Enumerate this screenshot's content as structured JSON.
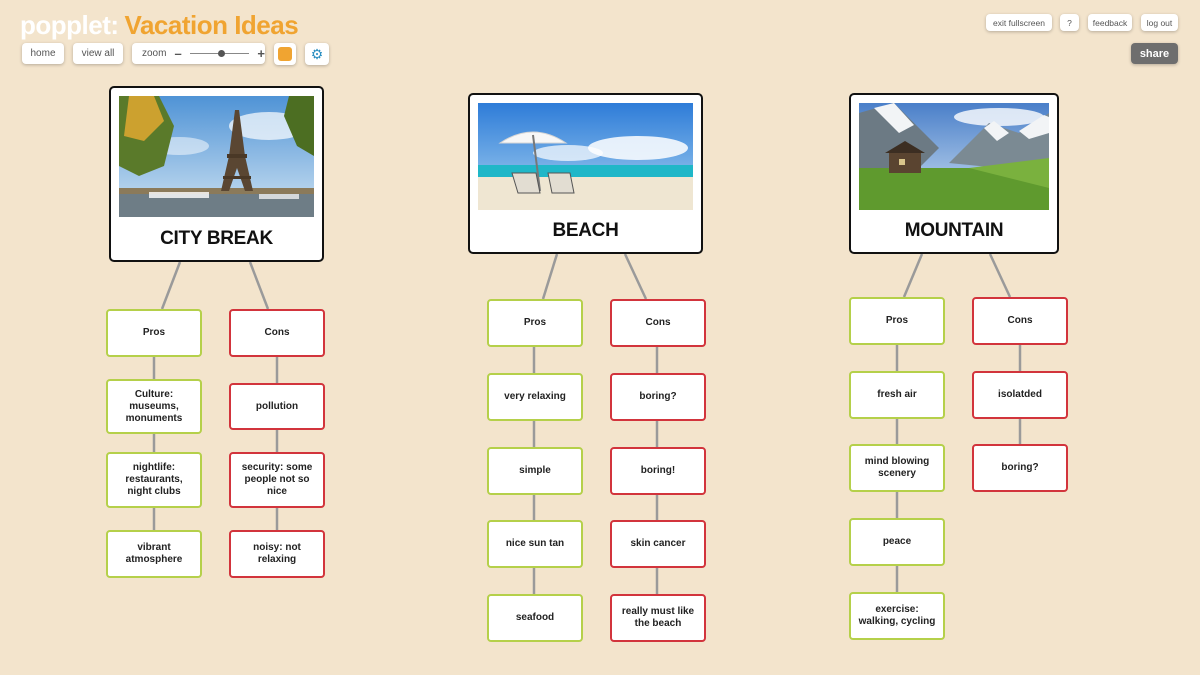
{
  "app": {
    "brand": "popplet:",
    "title": "Vacation Ideas"
  },
  "toolbar": {
    "home_label": "home",
    "view_all_label": "view all",
    "zoom_label": "zoom",
    "zoom_minus": "–",
    "zoom_plus": "+",
    "color_swatch": "#f0a431",
    "settings_icon": "gear-icon"
  },
  "top_right": {
    "exit_fullscreen": "exit fullscreen",
    "help": "?",
    "feedback": "feedback",
    "logout": "log out",
    "share": "share"
  },
  "colors": {
    "pro_border": "#b5d04a",
    "con_border": "#d2343c",
    "background": "#f3e4cc",
    "accent": "#f0a431"
  },
  "categories": [
    {
      "label": "CITY BREAK",
      "pros_label": "Pros",
      "cons_label": "Cons",
      "pros": [
        "Culture: museums, monuments",
        "nightlife: restaurants, night clubs",
        "vibrant atmosphere"
      ],
      "cons": [
        "pollution",
        "security: some people not so nice",
        "noisy: not relaxing"
      ]
    },
    {
      "label": "BEACH",
      "pros_label": "Pros",
      "cons_label": "Cons",
      "pros": [
        "very relaxing",
        "simple",
        "nice sun tan",
        "seafood"
      ],
      "cons": [
        "boring?",
        "boring!",
        "skin cancer",
        "really must like the beach"
      ]
    },
    {
      "label": "MOUNTAIN",
      "pros_label": "Pros",
      "cons_label": "Cons",
      "pros": [
        "fresh air",
        "mind blowing scenery",
        "peace",
        "exercise: walking, cycling"
      ],
      "cons": [
        "isolatded",
        "boring?"
      ]
    }
  ]
}
